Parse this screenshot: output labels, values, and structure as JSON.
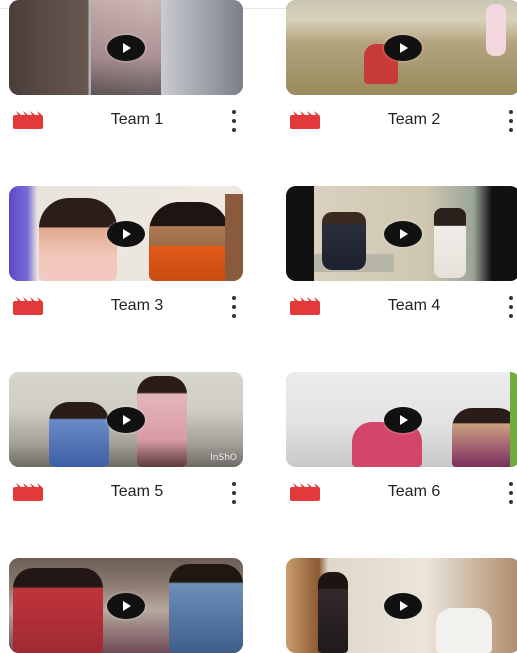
{
  "videos": [
    {
      "title": "Team 1"
    },
    {
      "title": "Team 2"
    },
    {
      "title": "Team 3"
    },
    {
      "title": "Team 4"
    },
    {
      "title": "Team 5"
    },
    {
      "title": "Team 6"
    },
    {
      "title": ""
    },
    {
      "title": ""
    }
  ],
  "watermark": "InShO",
  "icons": {
    "video": "clapperboard-icon",
    "play": "play-icon",
    "more": "more-vert-icon"
  },
  "colors": {
    "clapper": "#e23a3a",
    "accent": "#1a73e8"
  }
}
